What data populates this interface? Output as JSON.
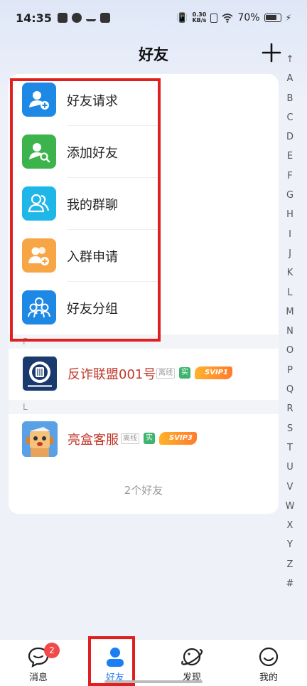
{
  "status_bar": {
    "time": "14:35",
    "net_speed_value": "0.30",
    "net_speed_unit": "KB/s",
    "battery_percent": "70%"
  },
  "header": {
    "title": "好友"
  },
  "index_letters": [
    "↑",
    "A",
    "B",
    "C",
    "D",
    "E",
    "F",
    "G",
    "H",
    "I",
    "J",
    "K",
    "L",
    "M",
    "N",
    "O",
    "P",
    "Q",
    "R",
    "S",
    "T",
    "U",
    "V",
    "W",
    "X",
    "Y",
    "Z",
    "#"
  ],
  "menu": [
    {
      "label": "好友请求",
      "color": "#1e88e5",
      "icon": "add-user-icon"
    },
    {
      "label": "添加好友",
      "color": "#3cb44b",
      "icon": "search-user-icon"
    },
    {
      "label": "我的群聊",
      "color": "#1fb6e8",
      "icon": "group-chat-icon"
    },
    {
      "label": "入群申请",
      "color": "#f7a545",
      "icon": "join-group-icon"
    },
    {
      "label": "好友分组",
      "color": "#1e88e5",
      "icon": "friend-group-icon"
    }
  ],
  "sections": [
    {
      "letter": "F",
      "friends": [
        {
          "name": "反诈联盟001号",
          "status": "离线",
          "real": "实",
          "vip": "SVIP1"
        }
      ]
    },
    {
      "letter": "L",
      "friends": [
        {
          "name": "亮盒客服",
          "status": "离线",
          "real": "实",
          "vip": "SVIP3"
        }
      ]
    }
  ],
  "friend_count": "2个好友",
  "bottom_nav": [
    {
      "label": "消息",
      "badge": "2"
    },
    {
      "label": "好友"
    },
    {
      "label": "发现"
    },
    {
      "label": "我的"
    }
  ],
  "colors": {
    "accent": "#1c7ef5",
    "name_red": "#c0392b",
    "highlight_red": "#e02020"
  }
}
